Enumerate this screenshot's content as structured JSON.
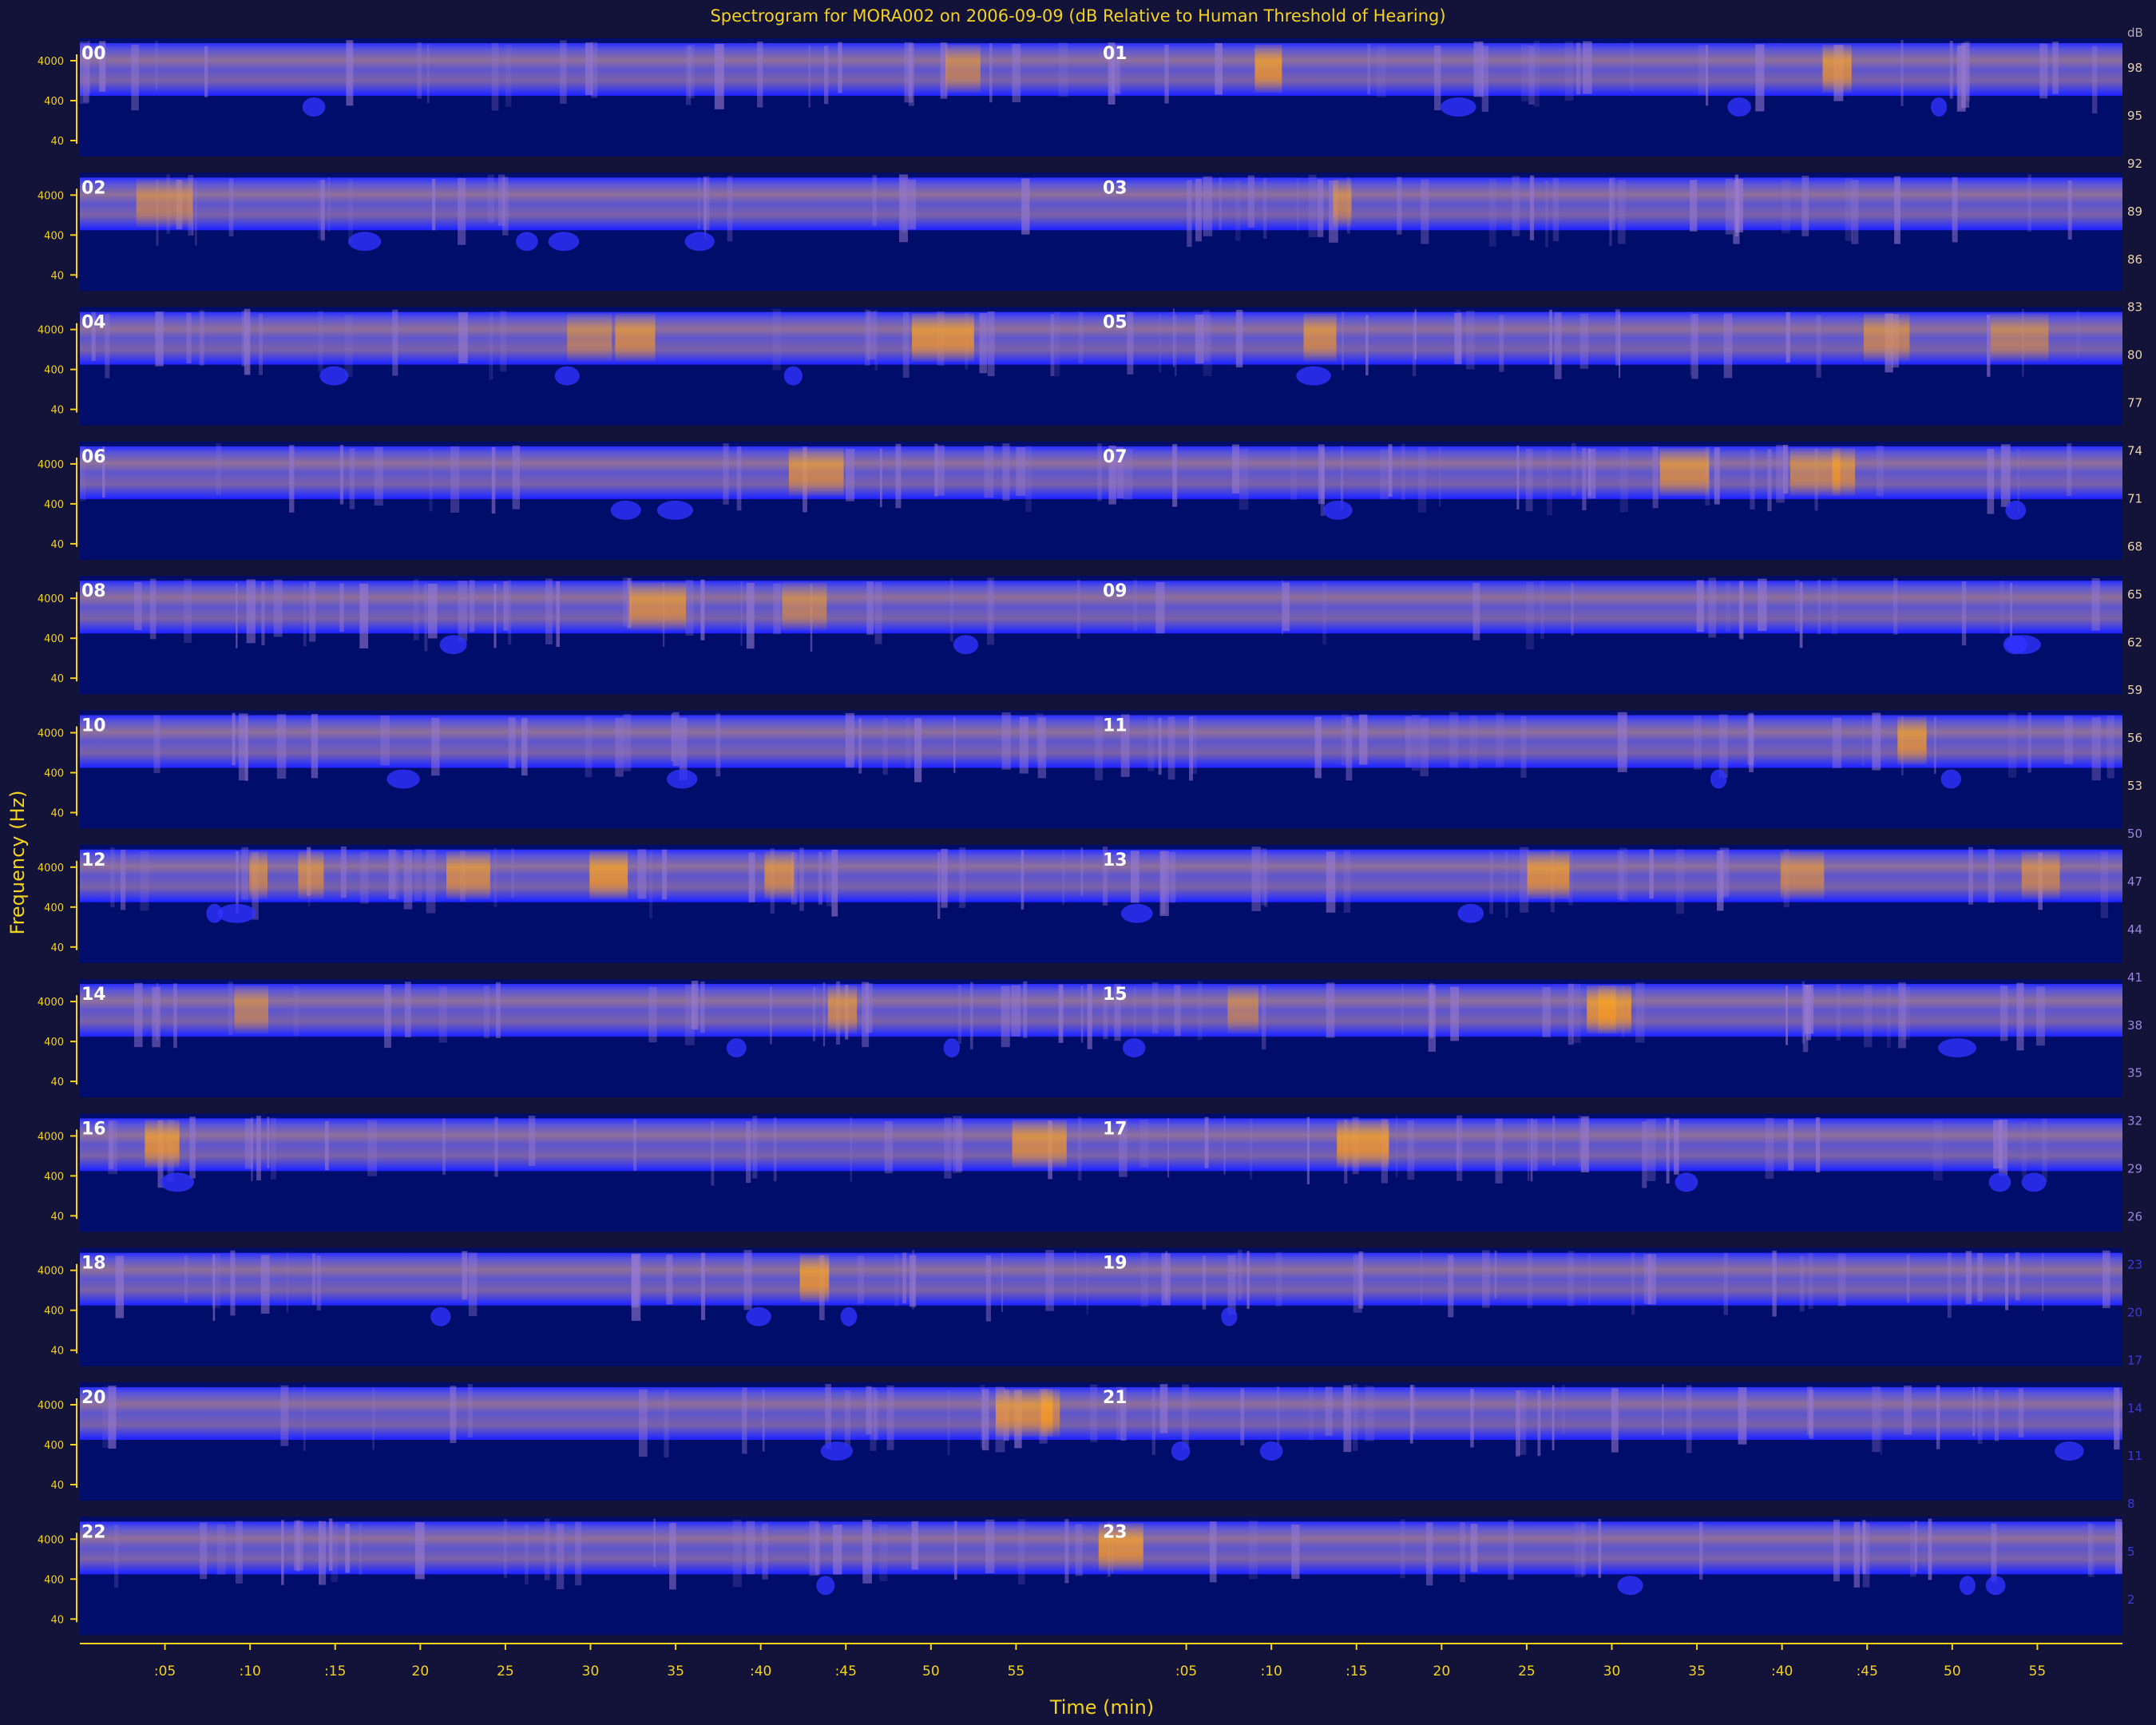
{
  "title": "Spectrogram for MORA002 on 2006-09-09 (dB Relative to Human Threshold of Hearing)",
  "chart_data": {
    "type": "heatmap",
    "title": "Spectrogram for MORA002 on 2006-09-09 (dB Relative to Human Threshold of Hearing)",
    "xlabel": "Time (min)",
    "ylabel": "Frequency (Hz)",
    "hours": [
      "00",
      "01",
      "02",
      "03",
      "04",
      "05",
      "06",
      "07",
      "08",
      "09",
      "10",
      "11",
      "12",
      "13",
      "14",
      "15",
      "16",
      "17",
      "18",
      "19",
      "20",
      "21",
      "22",
      "23"
    ],
    "freq_ticks": [
      "4000",
      "400",
      "40"
    ],
    "time_ticks": [
      ":05",
      ":10",
      ":15",
      "20",
      "25",
      "30",
      "35",
      ":40",
      ":45",
      "50",
      "55"
    ],
    "colorbar_label": "dB",
    "colorbar_ticks": [
      98,
      95,
      92,
      89,
      86,
      83,
      80,
      77,
      74,
      71,
      68,
      65,
      62,
      59,
      56,
      53,
      50,
      47,
      44,
      41,
      38,
      35,
      32,
      29,
      26,
      23,
      20,
      17,
      14,
      11,
      8,
      5,
      2
    ],
    "colorbar_range": [
      0,
      100
    ],
    "colors": {
      "background": "#13133a",
      "low": "#000d6b",
      "mid": "#2a2cff",
      "high": "#ffa51f",
      "text": "#f2d21a",
      "hour_label": "#ffffff"
    }
  }
}
